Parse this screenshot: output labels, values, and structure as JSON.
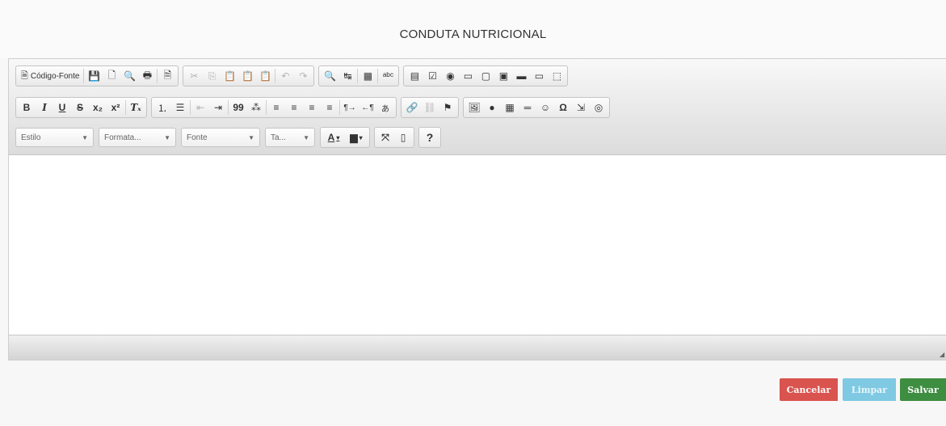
{
  "header": {
    "title": "CONDUTA NUTRICIONAL"
  },
  "toolbar": {
    "row1": {
      "source_label": "Código-Fonte",
      "icons": {
        "save": "💾",
        "new_page": "🗋",
        "preview": "🔍",
        "print": "🖶",
        "templates": "🗎",
        "cut": "✂",
        "copy": "⎘",
        "paste": "📋",
        "paste_text": "📋",
        "paste_word": "📋",
        "undo": "↶",
        "redo": "↷",
        "find": "🔍",
        "replace": "↹",
        "select_all": "▦",
        "spellcheck": "ᵃᵇᶜ",
        "form": "▤",
        "checkbox": "☑",
        "radio": "◉",
        "textfield": "▭",
        "textarea": "▢",
        "select": "▣",
        "button": "▬",
        "imagebutton": "▭",
        "hiddenfield": "⬚"
      }
    },
    "row2": {
      "bold": "B",
      "italic": "I",
      "underline": "U",
      "strike": "S",
      "subscript": "x₂",
      "superscript": "x²",
      "remove_format": "Tₓ",
      "icons": {
        "numbered_list": "⒈",
        "bulleted_list": "☰",
        "outdent": "⇤",
        "indent": "⇥",
        "blockquote": "99",
        "div": "⁂",
        "align_left": "≡",
        "align_center": "≡",
        "align_right": "≡",
        "justify": "≡",
        "ltr": "¶→",
        "rtl": "←¶",
        "language": "あ",
        "link": "🔗",
        "unlink": "⛓",
        "anchor": "⚑",
        "image": "🖼",
        "flash": "●",
        "table": "▦",
        "hline": "═",
        "smiley": "☺",
        "special_char": "Ω",
        "page_break": "⇲",
        "iframe": "◎"
      }
    },
    "row3": {
      "style": "Estilo",
      "format": "Formata...",
      "font": "Fonte",
      "size": "Ta...",
      "text_color": "A",
      "bg_color": "▆",
      "icons": {
        "maximize": "⤧",
        "show_blocks": "▯",
        "about": "?"
      }
    }
  },
  "editor": {
    "content": ""
  },
  "actions": {
    "cancel": "Cancelar",
    "clear": "Limpar",
    "save": "Salvar"
  },
  "colors": {
    "cancel": "#d9534f",
    "clear": "#7fc9e2",
    "save": "#3e8e41"
  }
}
